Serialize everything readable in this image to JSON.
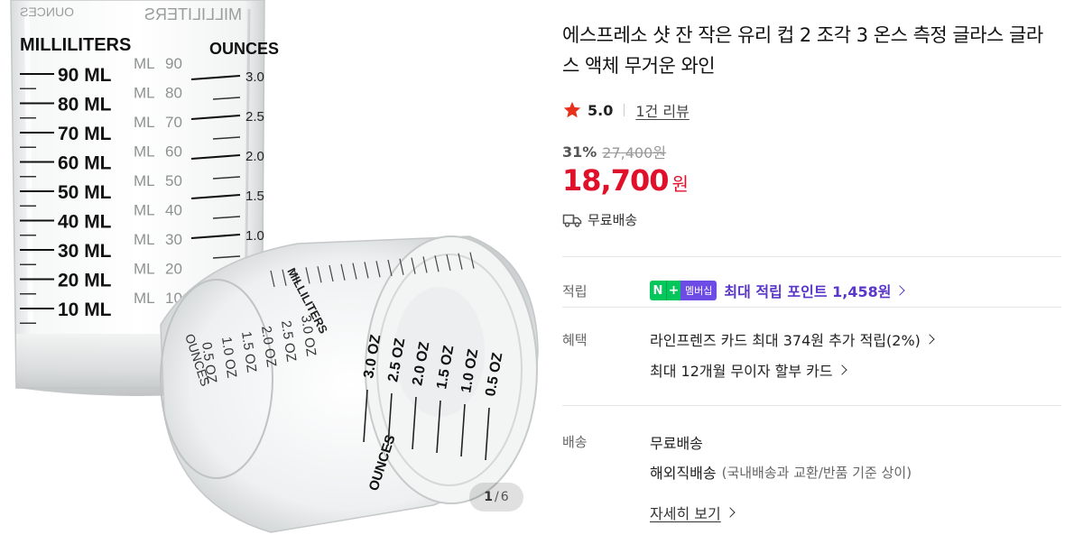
{
  "gallery": {
    "page_current": "1",
    "page_separator": "/",
    "page_total": "6",
    "glass_back": {
      "header_left": "MILLILITERS",
      "header_right": "OUNCES",
      "mirror_left": "OUNCES",
      "mirror_right": "MILLILITERS",
      "ml_marks": [
        "90 ML",
        "80 ML",
        "70 ML",
        "60 ML",
        "50 ML",
        "40 ML",
        "30 ML",
        "20 ML",
        "10 ML"
      ],
      "ghost_ml_marks": [
        "90",
        "80",
        "70",
        "60",
        "50",
        "40",
        "30",
        "20",
        "10"
      ],
      "ghost_ml_unit": "ML",
      "oz_marks": [
        "3.0",
        "2.5",
        "2.0",
        "1.5",
        "1.0"
      ]
    },
    "glass_front": {
      "oz_marks": [
        "0.5 OZ",
        "1.0 OZ",
        "1.5 OZ",
        "2.0 OZ",
        "2.5 OZ",
        "3.0 OZ"
      ],
      "ounces_label": "OUNCES",
      "milliliters_label": "MILLILITERS",
      "mirror_oz": [
        "0.5",
        "1.0",
        "1.5",
        "2.0",
        "2.5",
        "3.0"
      ],
      "mirror_oz_unit": "OZ",
      "mirror_ounces": "OUNCES"
    }
  },
  "product": {
    "title": "에스프레소 샷 잔 작은 유리 컵 2 조각 3 온스 측정 글라스 글라스 액체 무거운 와인",
    "rating": "5.0",
    "review_link": "1건 리뷰",
    "discount_rate": "31%",
    "original_price": "27,400원",
    "price": "18,700",
    "currency": "원",
    "shipping_summary": "무료배송"
  },
  "details": {
    "points": {
      "label": "적립",
      "badge_n": "N",
      "badge_plus": "+",
      "badge_membership": "멤버십",
      "text": "최대 적립 포인트 1,458원"
    },
    "benefits": {
      "label": "혜택",
      "line1": "라인프렌즈 카드 최대 374원 추가 적립(2%)",
      "line2": "최대 12개월 무이자 할부 카드"
    },
    "delivery": {
      "label": "배송",
      "line1": "무료배송",
      "line2_main": "해외직배송",
      "line2_note": "(국내배송과 교환/반품 기준 상이)",
      "more_link": "자세히 보기"
    }
  },
  "colors": {
    "price_red": "#e0102a",
    "star_red": "#e8311c",
    "npay_green": "#03c75a",
    "membership_purple": "#6d4ce6",
    "points_purple": "#5a36c9"
  },
  "icons": [
    "star-icon",
    "truck-icon",
    "chevron-right-icon"
  ]
}
